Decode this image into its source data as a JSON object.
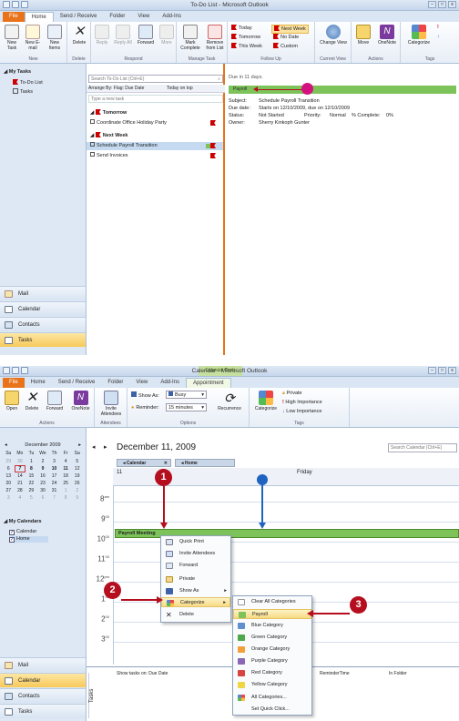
{
  "top": {
    "title": "To-Do List - Microsoft Outlook",
    "tabs": [
      "File",
      "Home",
      "Send / Receive",
      "Folder",
      "View",
      "Add-Ins"
    ],
    "groups": {
      "new": "New",
      "delete": "Delete",
      "respond": "Respond",
      "manage": "Manage Task",
      "follow": "Follow Up",
      "current": "Current View",
      "actions": "Actions",
      "tags": "Tags"
    },
    "buttons": {
      "new_task": "New Task",
      "new_email": "New E-mail",
      "new_items": "New Items",
      "delete": "Delete",
      "reply": "Reply",
      "reply_all": "Reply All",
      "forward": "Forward",
      "more": "More",
      "mark_complete": "Mark Complete",
      "remove_list": "Remove from List",
      "change_view": "Change View",
      "move": "Move",
      "onenote": "OneNote",
      "categorize": "Categorize"
    },
    "follow": [
      "Today",
      "Tomorrow",
      "This Week",
      "Next Week",
      "No Date",
      "Custom"
    ],
    "nav": {
      "header": "My Tasks",
      "items": [
        "To-Do List",
        "Tasks"
      ],
      "buttons": [
        "Mail",
        "Calendar",
        "Contacts",
        "Tasks"
      ]
    },
    "list": {
      "search_placeholder": "Search To-Do List (Ctrl+E)",
      "arrange": "Arrange By: Flag: Due Date",
      "order": "Today on top",
      "new_task": "Type a new task",
      "groups": [
        {
          "label": "Tomorrow",
          "items": [
            "Coordinate Office Holiday Party"
          ]
        },
        {
          "label": "Next Week",
          "items": [
            "Schedule Payroll Transition",
            "Send Invoices"
          ]
        }
      ]
    },
    "detail": {
      "due": "Due in 11 days.",
      "category": "Payroll",
      "subject_label": "Subject:",
      "subject": "Schedule Payroll Transition",
      "due_label": "Due date:",
      "due_value": "Starts on 12/10/2009, due on 12/10/2009",
      "status_label": "Status:",
      "status": "Not Started",
      "priority_label": "Priority:",
      "priority": "Normal",
      "complete_label": "% Complete:",
      "complete": "0%",
      "owner_label": "Owner:",
      "owner": "Sherry Kinkoph Gunter"
    }
  },
  "bottom": {
    "title": "Calendar - Microsoft Outlook",
    "context_tab": "Calendar Tools",
    "tabs": [
      "File",
      "Home",
      "Send / Receive",
      "Folder",
      "View",
      "Add-Ins",
      "Appointment"
    ],
    "buttons": {
      "open": "Open",
      "delete": "Delete",
      "forward": "Forward",
      "onenote": "OneNote",
      "invite": "Invite Attendees",
      "show_as_label": "Show As:",
      "show_as": "Busy",
      "reminder_label": "Reminder:",
      "reminder": "15 minutes",
      "recurrence": "Recurrence",
      "categorize": "Categorize",
      "private": "Private",
      "high": "High Importance",
      "low": "Low Importance"
    },
    "groups": {
      "actions": "Actions",
      "attendees": "Attendees",
      "options": "Options",
      "tags": "Tags"
    },
    "mini_cal": {
      "month": "December 2009",
      "dow": [
        "Su",
        "Mo",
        "Tu",
        "We",
        "Th",
        "Fr",
        "Sa"
      ],
      "weeks": [
        [
          "29",
          "30",
          "1",
          "2",
          "3",
          "4",
          "5"
        ],
        [
          "6",
          "7",
          "8",
          "9",
          "10",
          "11",
          "12"
        ],
        [
          "13",
          "14",
          "15",
          "16",
          "17",
          "18",
          "19"
        ],
        [
          "20",
          "21",
          "22",
          "23",
          "24",
          "25",
          "26"
        ],
        [
          "27",
          "28",
          "29",
          "30",
          "31",
          "1",
          "2"
        ],
        [
          "3",
          "4",
          "5",
          "6",
          "7",
          "8",
          "9"
        ]
      ]
    },
    "my_calendars": "My Calendars",
    "calendars": [
      "Calendar",
      "Home"
    ],
    "nav_buttons": [
      "Mail",
      "Calendar",
      "Contacts",
      "Tasks"
    ],
    "date_heading": "December 11, 2009",
    "search_placeholder": "Search Calendar (Ctrl+E)",
    "cal_tabs": [
      "Calendar",
      "Home"
    ],
    "day_num": "11",
    "day_name": "Friday",
    "hours": [
      {
        "h": "8",
        "s": "am"
      },
      {
        "h": "9",
        "s": "00"
      },
      {
        "h": "10",
        "s": "00"
      },
      {
        "h": "11",
        "s": "00"
      },
      {
        "h": "12",
        "s": "pm"
      },
      {
        "h": "1",
        "s": "00"
      },
      {
        "h": "2",
        "s": "00"
      },
      {
        "h": "3",
        "s": "00"
      }
    ],
    "appointment": "Payroll Meeting",
    "context_menu": [
      "Quick Print",
      "Invite Attendees",
      "Forward",
      "Private",
      "Show As",
      "Categorize",
      "Delete"
    ],
    "submenu": [
      "Clear All Categories",
      "Payroll",
      "Blue Category",
      "Green Category",
      "Orange Category",
      "Purple Category",
      "Red Category",
      "Yellow Category",
      "All Categories...",
      "Set Quick Click..."
    ],
    "tasks_bar": {
      "label": "Tasks",
      "show": "Show tasks on: Due Date",
      "reminder": "ReminderTime",
      "folder": "In Folder"
    },
    "callouts": [
      "1",
      "2",
      "3"
    ]
  },
  "colors": {
    "accent": "#e8731a",
    "callout": "#b50e1e",
    "payroll": "#7dc35a",
    "highlight": "#f7da83",
    "selection": "#f7c95a"
  }
}
